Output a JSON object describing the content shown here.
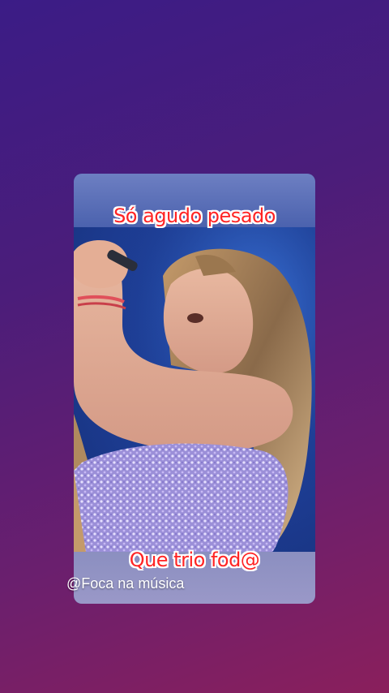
{
  "story": {
    "caption_top": "Só agudo pesado",
    "caption_bottom": "Que trio fod@",
    "watermark": "@Foca na música"
  },
  "colors": {
    "background_top": "#3b1c86",
    "background_bottom": "#8a1f5c",
    "caption_text": "#ff2424",
    "caption_outline": "#ffffff",
    "stage_blue": "#1e3f98"
  }
}
